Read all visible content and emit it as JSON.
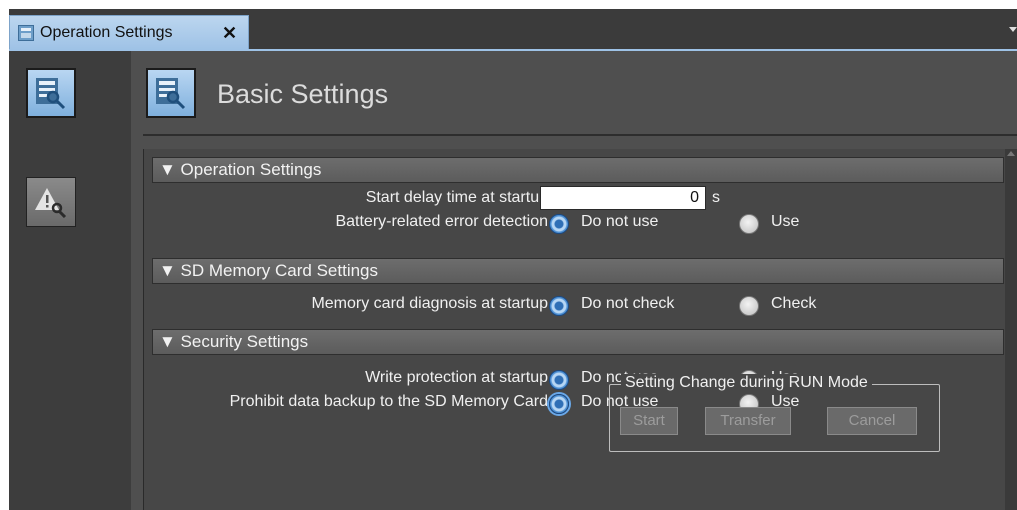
{
  "tab": {
    "title": "Operation Settings",
    "close_glyph": "✕"
  },
  "header": {
    "title": "Basic Settings"
  },
  "sections": {
    "operation": {
      "title": "▼ Operation Settings",
      "start_delay_label": "Start delay time at startup",
      "start_delay_value": "0",
      "start_delay_unit": "s",
      "battery_label": "Battery-related error detection",
      "battery_opt1": "Do not use",
      "battery_opt2": "Use"
    },
    "sd": {
      "title": "▼ SD Memory Card Settings",
      "diagnosis_label": "Memory card diagnosis at startup",
      "diagnosis_opt1": "Do not check",
      "diagnosis_opt2": "Check"
    },
    "security": {
      "title": "▼ Security Settings",
      "write_label": "Write protection at startup",
      "write_opt1": "Do not use",
      "write_opt2": "Use",
      "backup_label": "Prohibit data backup to the SD Memory Card",
      "backup_opt1": "Do not use",
      "backup_opt2": "Use"
    }
  },
  "run_mode": {
    "title": "Setting Change during RUN Mode",
    "start": "Start",
    "transfer": "Transfer",
    "cancel": "Cancel"
  },
  "icons": {
    "rail_basic": "basic-settings-icon",
    "rail_alt": "warning-settings-icon"
  },
  "colors": {
    "accent": "#9ec2e6",
    "panel": "#474747",
    "radio_selected": "#2f6fb6"
  }
}
